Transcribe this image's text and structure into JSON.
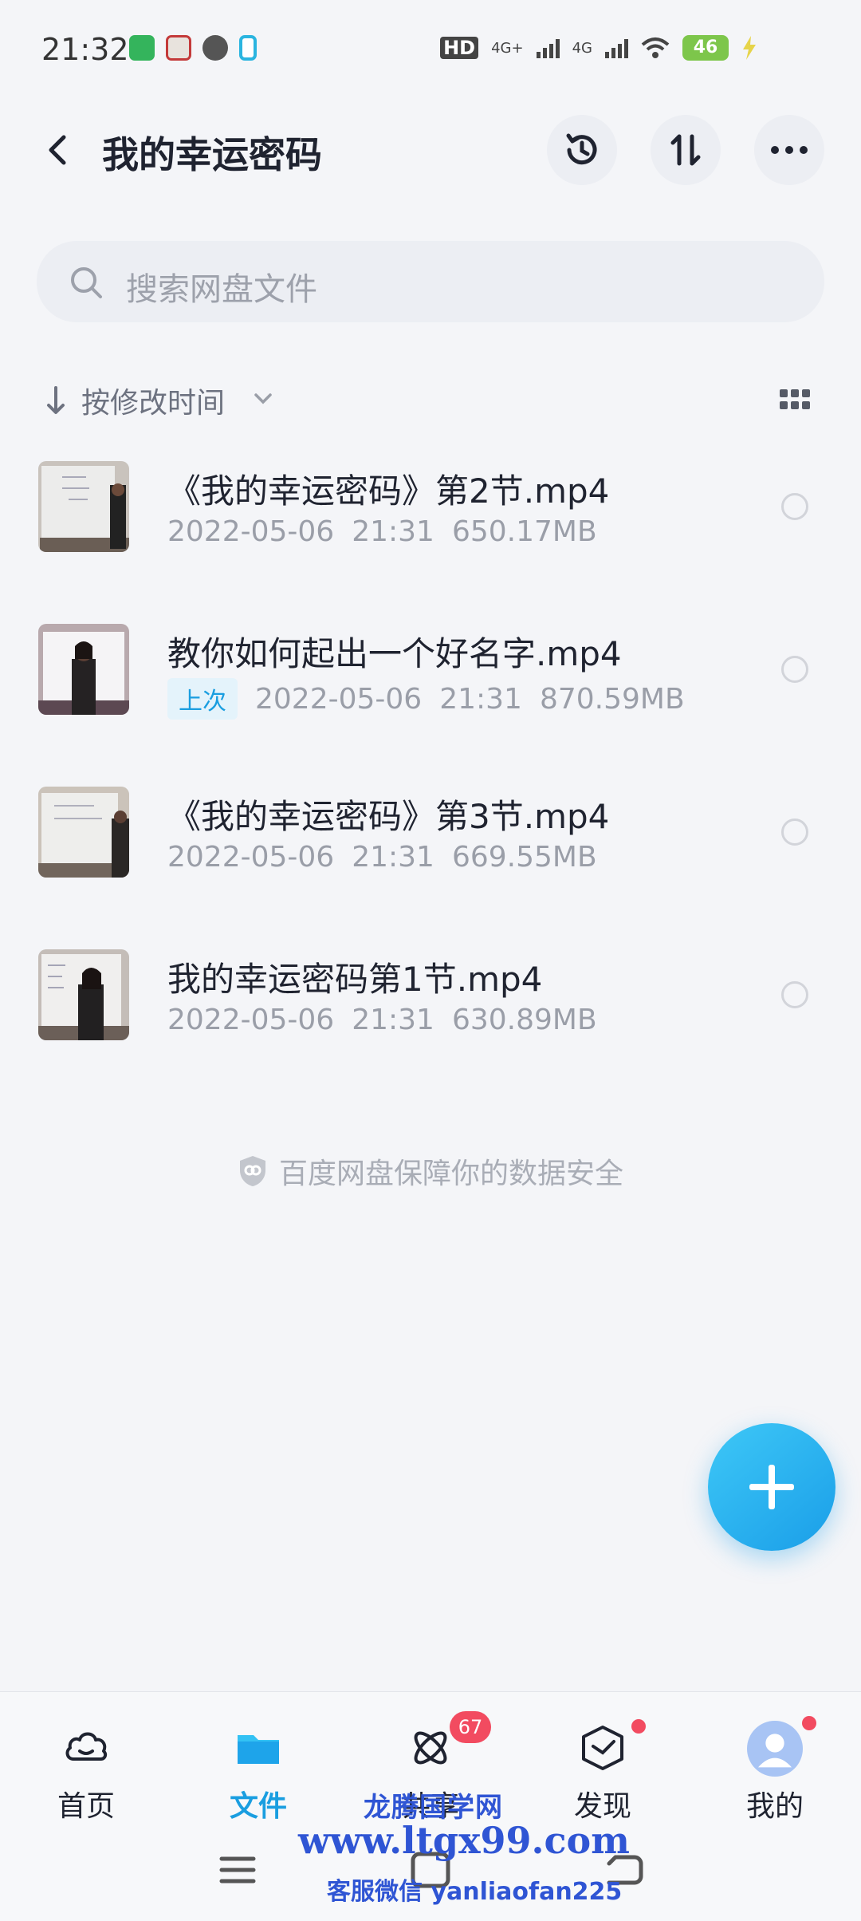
{
  "status_bar": {
    "time": "21:32",
    "network_labels": [
      "HD",
      "4G+",
      "4G"
    ],
    "battery": "46"
  },
  "header": {
    "title": "我的幸运密码",
    "icons": [
      "history-icon",
      "sort-order-icon",
      "more-icon"
    ]
  },
  "search": {
    "placeholder": "搜索网盘文件"
  },
  "sort": {
    "label": "按修改时间"
  },
  "files": [
    {
      "name": "《我的幸运密码》第2节.mp4",
      "date": "2022-05-06",
      "time": "21:31",
      "size": "650.17MB",
      "badge": ""
    },
    {
      "name": "教你如何起出一个好名字.mp4",
      "date": "2022-05-06",
      "time": "21:31",
      "size": "870.59MB",
      "badge": "上次"
    },
    {
      "name": "《我的幸运密码》第3节.mp4",
      "date": "2022-05-06",
      "time": "21:31",
      "size": "669.55MB",
      "badge": ""
    },
    {
      "name": "我的幸运密码第1节.mp4",
      "date": "2022-05-06",
      "time": "21:31",
      "size": "630.89MB",
      "badge": ""
    }
  ],
  "safety_note": "百度网盘保障你的数据安全",
  "bottom_nav": {
    "tabs": [
      {
        "label": "首页",
        "icon": "cloud-home-icon"
      },
      {
        "label": "文件",
        "icon": "folder-icon"
      },
      {
        "label": "共享",
        "icon": "share-atom-icon",
        "badge": "67"
      },
      {
        "label": "发现",
        "icon": "discover-box-icon"
      },
      {
        "label": "我的",
        "icon": "avatar-icon"
      }
    ],
    "active": "文件"
  },
  "watermark": {
    "line1": "龙腾国学网",
    "line2": "www.ltgx99.com",
    "line3": "客服微信 yanliaofan225"
  },
  "colors": {
    "accent": "#1a9ee0",
    "badge": "#f24b60",
    "background": "#f4f5f8"
  }
}
